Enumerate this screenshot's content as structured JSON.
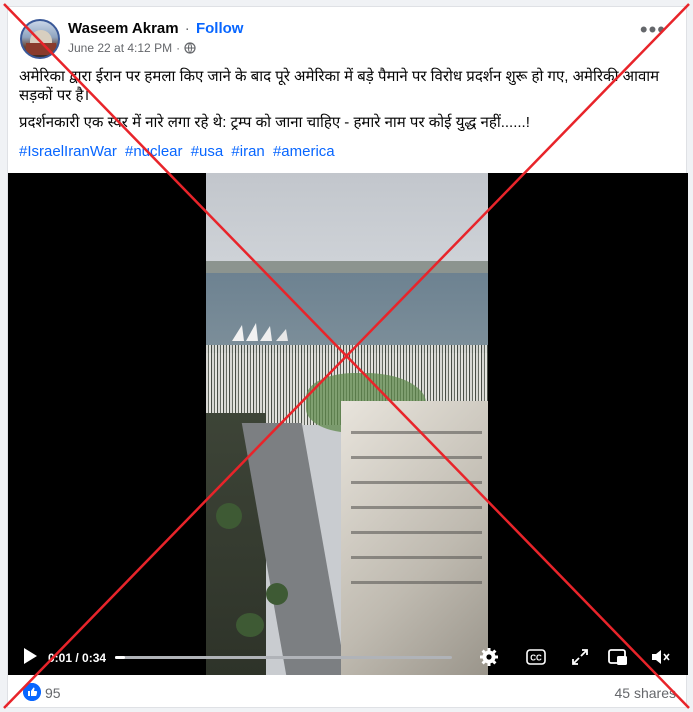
{
  "post": {
    "author": "Waseem Akram",
    "separator": "·",
    "follow_label": "Follow",
    "timestamp": "June 22 at 4:12 PM",
    "meta_separator": "·",
    "audience_icon": "globe-icon",
    "more_icon": "more-options-icon",
    "more_label": "•••",
    "text_para1": "अमेरिका द्वारा ईरान पर हमला किए जाने के बाद पूरे अमेरिका में बड़े पैमाने पर विरोध प्रदर्शन शुरू हो गए, अमेरिकी आवाम सड़कों पर है।",
    "text_para2": "प्रदर्शनकारी एक स्वर में नारे लगा रहे थे: ट्रम्प को जाना चाहिए - हमारे नाम पर कोई युद्ध नहीं......!",
    "hashtags": [
      "#IsraelIranWar",
      "#nuclear",
      "#usa",
      "#iran",
      "#america"
    ]
  },
  "video": {
    "current_time": "0:01",
    "time_separator": " / ",
    "duration": "0:34",
    "progress": 0.03,
    "icons": [
      "play-icon",
      "settings-icon",
      "captions-icon",
      "fullscreen-icon",
      "picture-in-picture-icon",
      "mute-icon"
    ],
    "cc_label": "CC"
  },
  "footer": {
    "like_count": "95",
    "shares": "45 shares"
  },
  "overlay": {
    "type": "red-x",
    "color": "#e8242a"
  },
  "colors": {
    "link": "#0866ff",
    "secondary_text": "#65676b"
  }
}
